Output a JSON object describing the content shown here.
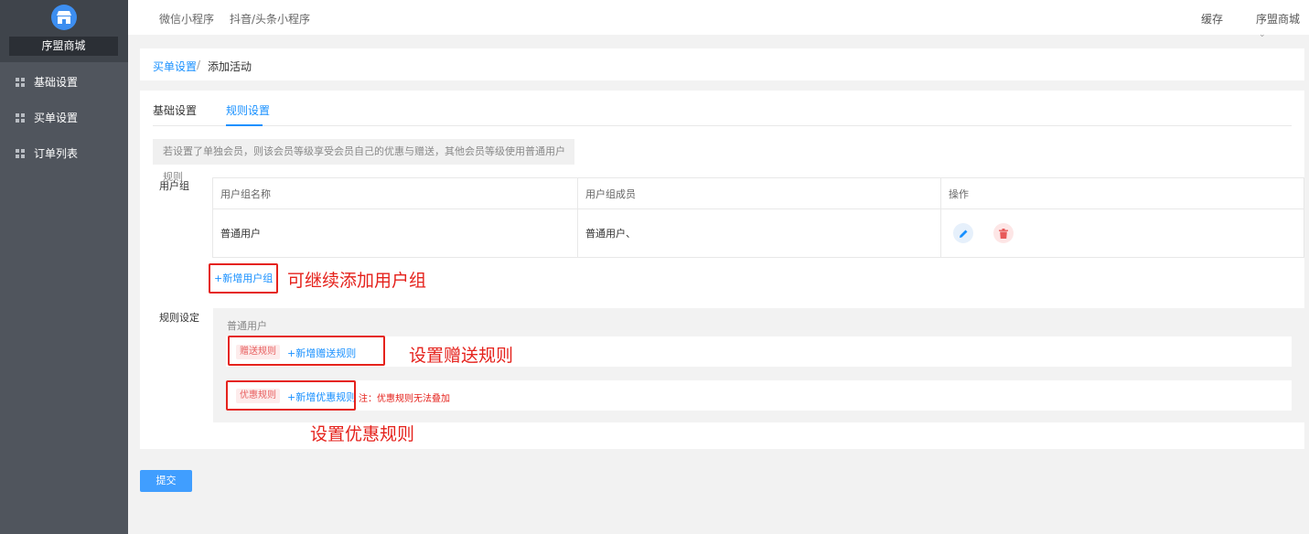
{
  "app": {
    "name": "序盟商城"
  },
  "sidebar": {
    "items": [
      {
        "label": "基础设置"
      },
      {
        "label": "买单设置"
      },
      {
        "label": "订单列表"
      }
    ]
  },
  "topbar": {
    "tabs": [
      "微信小程序",
      "抖音/头条小程序"
    ],
    "cache_label": "缓存",
    "store_label": "序盟商城",
    "dropdown_icon": "chevron-down-icon"
  },
  "breadcrumb": {
    "parent": "买单设置",
    "separator": "/",
    "current": "添加活动"
  },
  "tabs": [
    {
      "label": "基础设置",
      "active": false
    },
    {
      "label": "规则设置",
      "active": true
    }
  ],
  "notice": "若设置了单独会员，则该会员等级享受会员自己的优惠与赠送，其他会员等级使用普通用户规则",
  "user_group": {
    "label": "用户组",
    "columns": [
      "用户组名称",
      "用户组成员",
      "操作"
    ],
    "rows": [
      {
        "name": "普通用户",
        "members": "普通用户、"
      }
    ],
    "add_link": "+新增用户组"
  },
  "rules": {
    "label": "规则设定",
    "group_name": "普通用户",
    "gift": {
      "tag": "赠送规则",
      "add_link": "+新增赠送规则"
    },
    "discount": {
      "tag": "优惠规则",
      "add_link": "+新增优惠规则",
      "note": "注：优惠规则无法叠加"
    }
  },
  "annotations": {
    "add_group": "可继续添加用户组",
    "gift": "设置赠送规则",
    "discount": "设置优惠规则"
  },
  "submit_label": "提交",
  "colors": {
    "accent": "#1890ff",
    "annotation": "#e5221c",
    "sidebar": "#50555d"
  }
}
